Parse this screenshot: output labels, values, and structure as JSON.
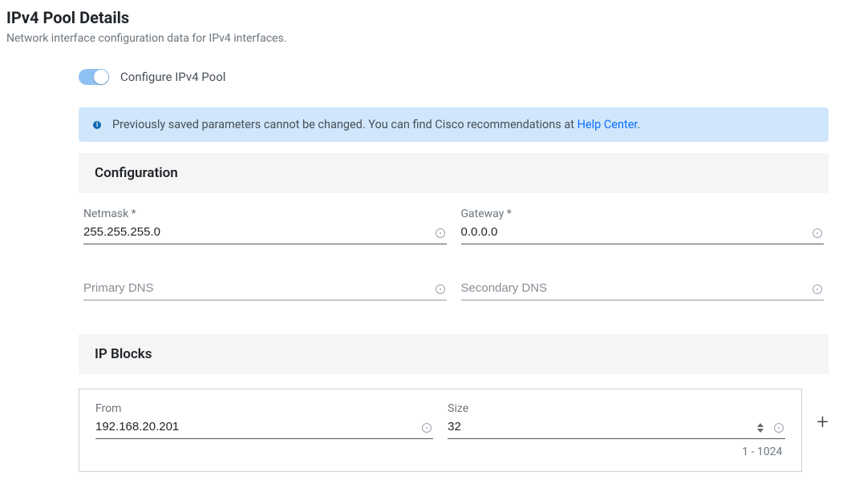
{
  "header": {
    "title": "IPv4 Pool Details",
    "subtitle": "Network interface configuration data for IPv4 interfaces."
  },
  "toggle": {
    "label": "Configure IPv4 Pool",
    "on": true
  },
  "info_banner": {
    "text": "Previously saved parameters cannot be changed. You can find Cisco recommendations at ",
    "link_text": "Help Center",
    "suffix": "."
  },
  "config": {
    "section_title": "Configuration",
    "netmask": {
      "label": "Netmask *",
      "value": "255.255.255.0"
    },
    "gateway": {
      "label": "Gateway *",
      "value": "0.0.0.0"
    },
    "primary_dns": {
      "placeholder": "Primary DNS",
      "value": ""
    },
    "secondary_dns": {
      "placeholder": "Secondary DNS",
      "value": ""
    }
  },
  "ip_blocks": {
    "section_title": "IP Blocks",
    "from": {
      "label": "From",
      "value": "192.168.20.201"
    },
    "size": {
      "label": "Size",
      "value": "32",
      "range_hint": "1 - 1024"
    }
  }
}
